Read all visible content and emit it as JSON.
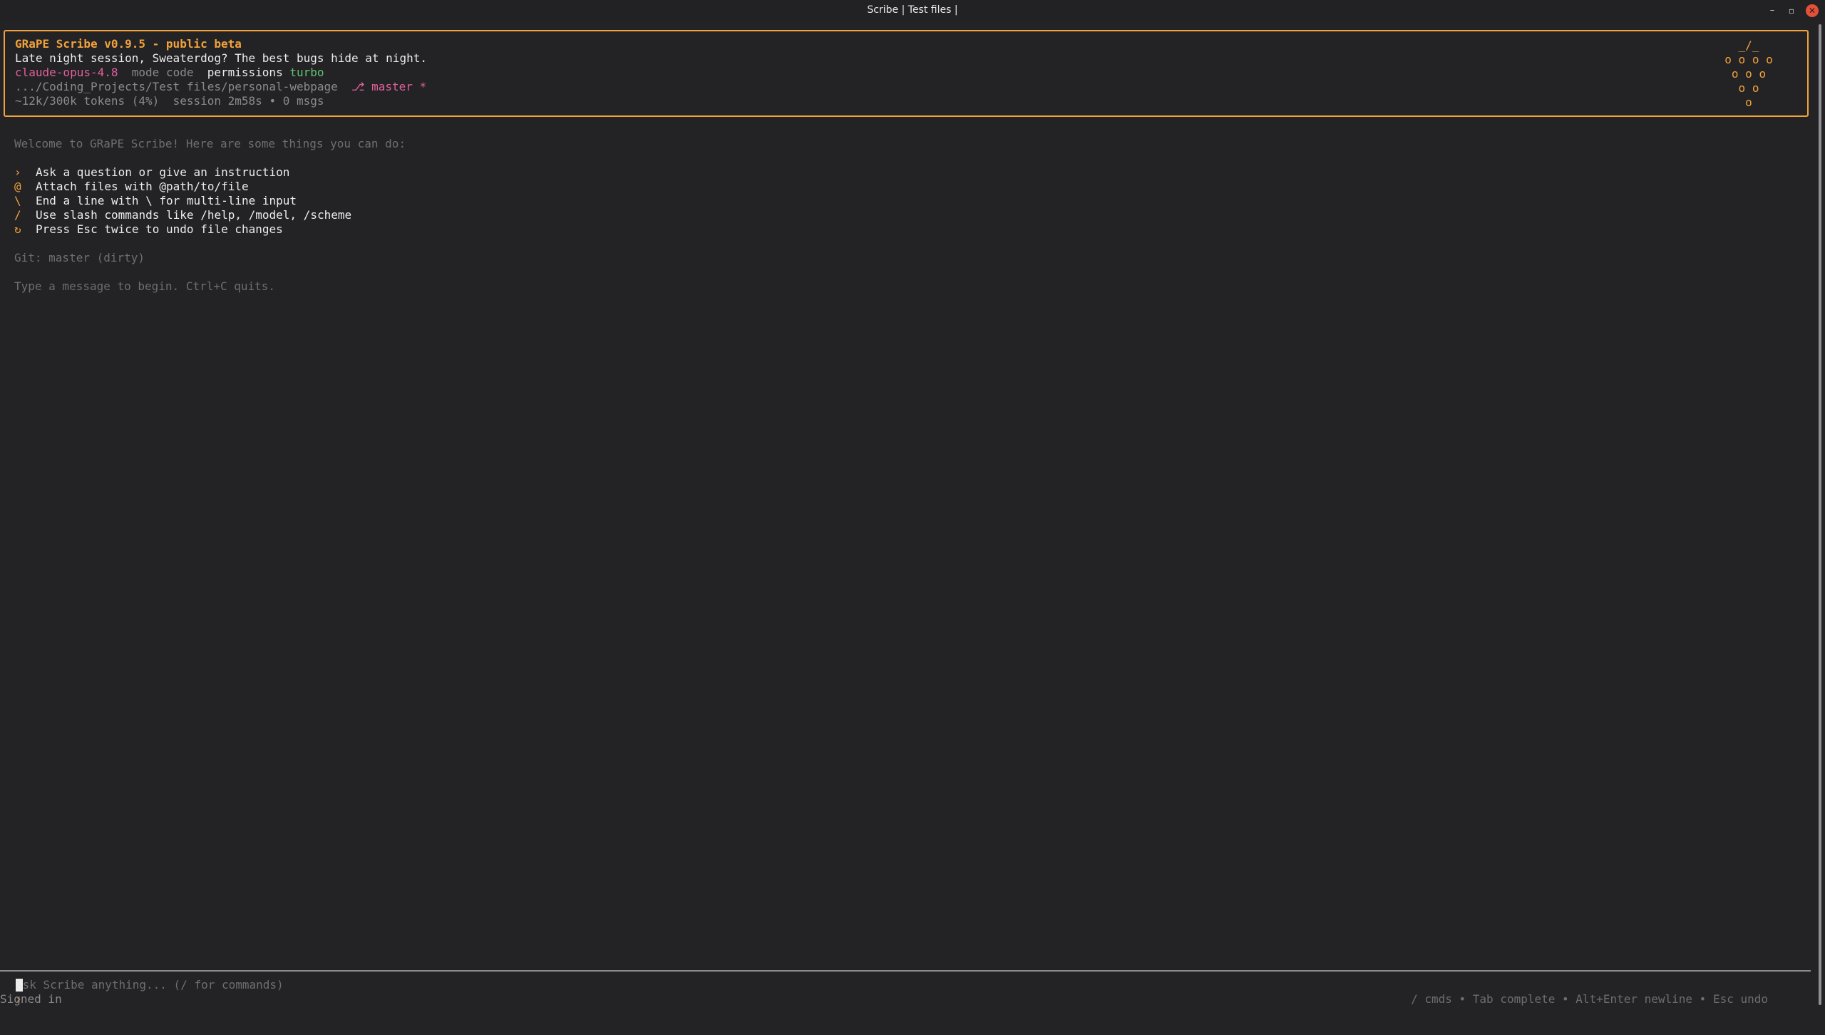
{
  "window": {
    "title": "Scribe | Test files |",
    "minimize_glyph": "–",
    "maximize_glyph": "▫",
    "close_glyph": "✕"
  },
  "header": {
    "app_title": "GRaPE Scribe v0.9.5 - public beta",
    "greeting": "Late night session, Sweaterdog? The best bugs hide at night.",
    "model": "claude-opus-4.8",
    "mode_label": "mode",
    "mode_value": "code",
    "permissions_label": "permissions",
    "permissions_value": "turbo",
    "path": ".../Coding_Projects/Test files/personal-webpage",
    "branch_glyph": "⎇",
    "branch": "master",
    "dirty_marker": "*",
    "tokens": "~12k/300k tokens (4%)",
    "session": "session 2m58s",
    "bullet": "•",
    "msgs": "0 msgs",
    "logo_lines": [
      "_/_",
      "o o o o",
      "o o o",
      "o o",
      "o"
    ]
  },
  "welcome": {
    "intro": "Welcome to GRaPE Scribe! Here are some things you can do:",
    "tips": [
      {
        "symbol": "›",
        "text": "Ask a question or give an instruction"
      },
      {
        "symbol": "@",
        "text": "Attach files with @path/to/file"
      },
      {
        "symbol": "\\",
        "text": "End a line with \\ for multi-line input"
      },
      {
        "symbol": "/",
        "text": "Use slash commands like /help, /model, /scheme"
      },
      {
        "symbol": "↻",
        "text": "Press Esc twice to undo file changes"
      }
    ],
    "git_status": "Git: master (dirty)",
    "start_hint": "Type a message to begin. Ctrl+C quits."
  },
  "prompt": {
    "chevron": "›",
    "value": "",
    "placeholder": "Ask Scribe anything... (/ for commands)"
  },
  "status_bar": {
    "left": "Signed in",
    "right": "/ cmds • Tab complete • Alt+Enter newline • Esc undo"
  },
  "colors": {
    "background": "#232326",
    "accent": "#f2a23b",
    "model": "#e0609a",
    "permissions": "#5fc46b",
    "close_button": "#e3503a"
  }
}
